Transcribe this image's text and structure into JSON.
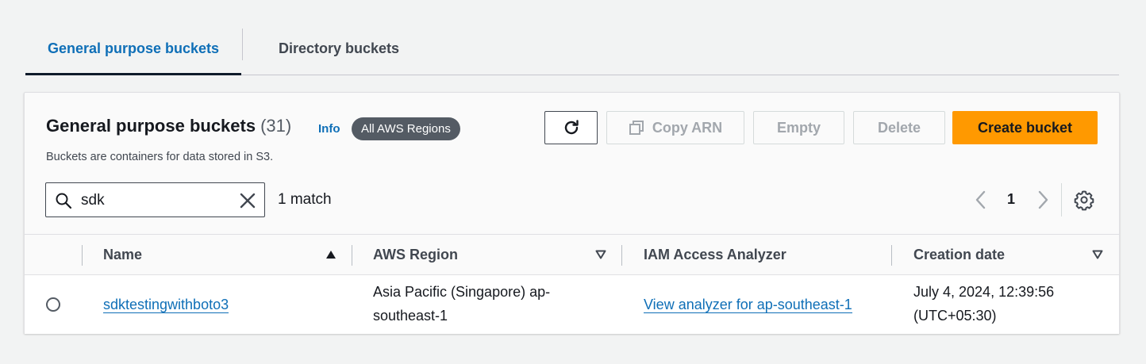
{
  "tabs": [
    {
      "label": "General purpose buckets",
      "active": true
    },
    {
      "label": "Directory buckets",
      "active": false
    }
  ],
  "panel": {
    "title": "General purpose buckets",
    "count": "(31)",
    "info": "Info",
    "region_badge": "All AWS Regions",
    "description": "Buckets are containers for data stored in S3."
  },
  "actions": {
    "refresh_icon": "refresh-icon",
    "copy_arn": "Copy ARN",
    "empty": "Empty",
    "delete": "Delete",
    "create": "Create bucket"
  },
  "search": {
    "value": "sdk",
    "match_text": "1 match"
  },
  "pagination": {
    "current_page": "1"
  },
  "table": {
    "columns": [
      "Name",
      "AWS Region",
      "IAM Access Analyzer",
      "Creation date"
    ],
    "rows": [
      {
        "name": "sdktestingwithboto3",
        "region_line1": "Asia Pacific (Singapore) ap-",
        "region_line2": "southeast-1",
        "analyzer": "View analyzer for ap-southeast-1",
        "created_line1": "July 4, 2024, 12:39:56",
        "created_line2": "(UTC+05:30)"
      }
    ]
  },
  "colors": {
    "accent": "#0f6fb7",
    "primary_button": "#ff9900",
    "badge": "#545b64"
  }
}
